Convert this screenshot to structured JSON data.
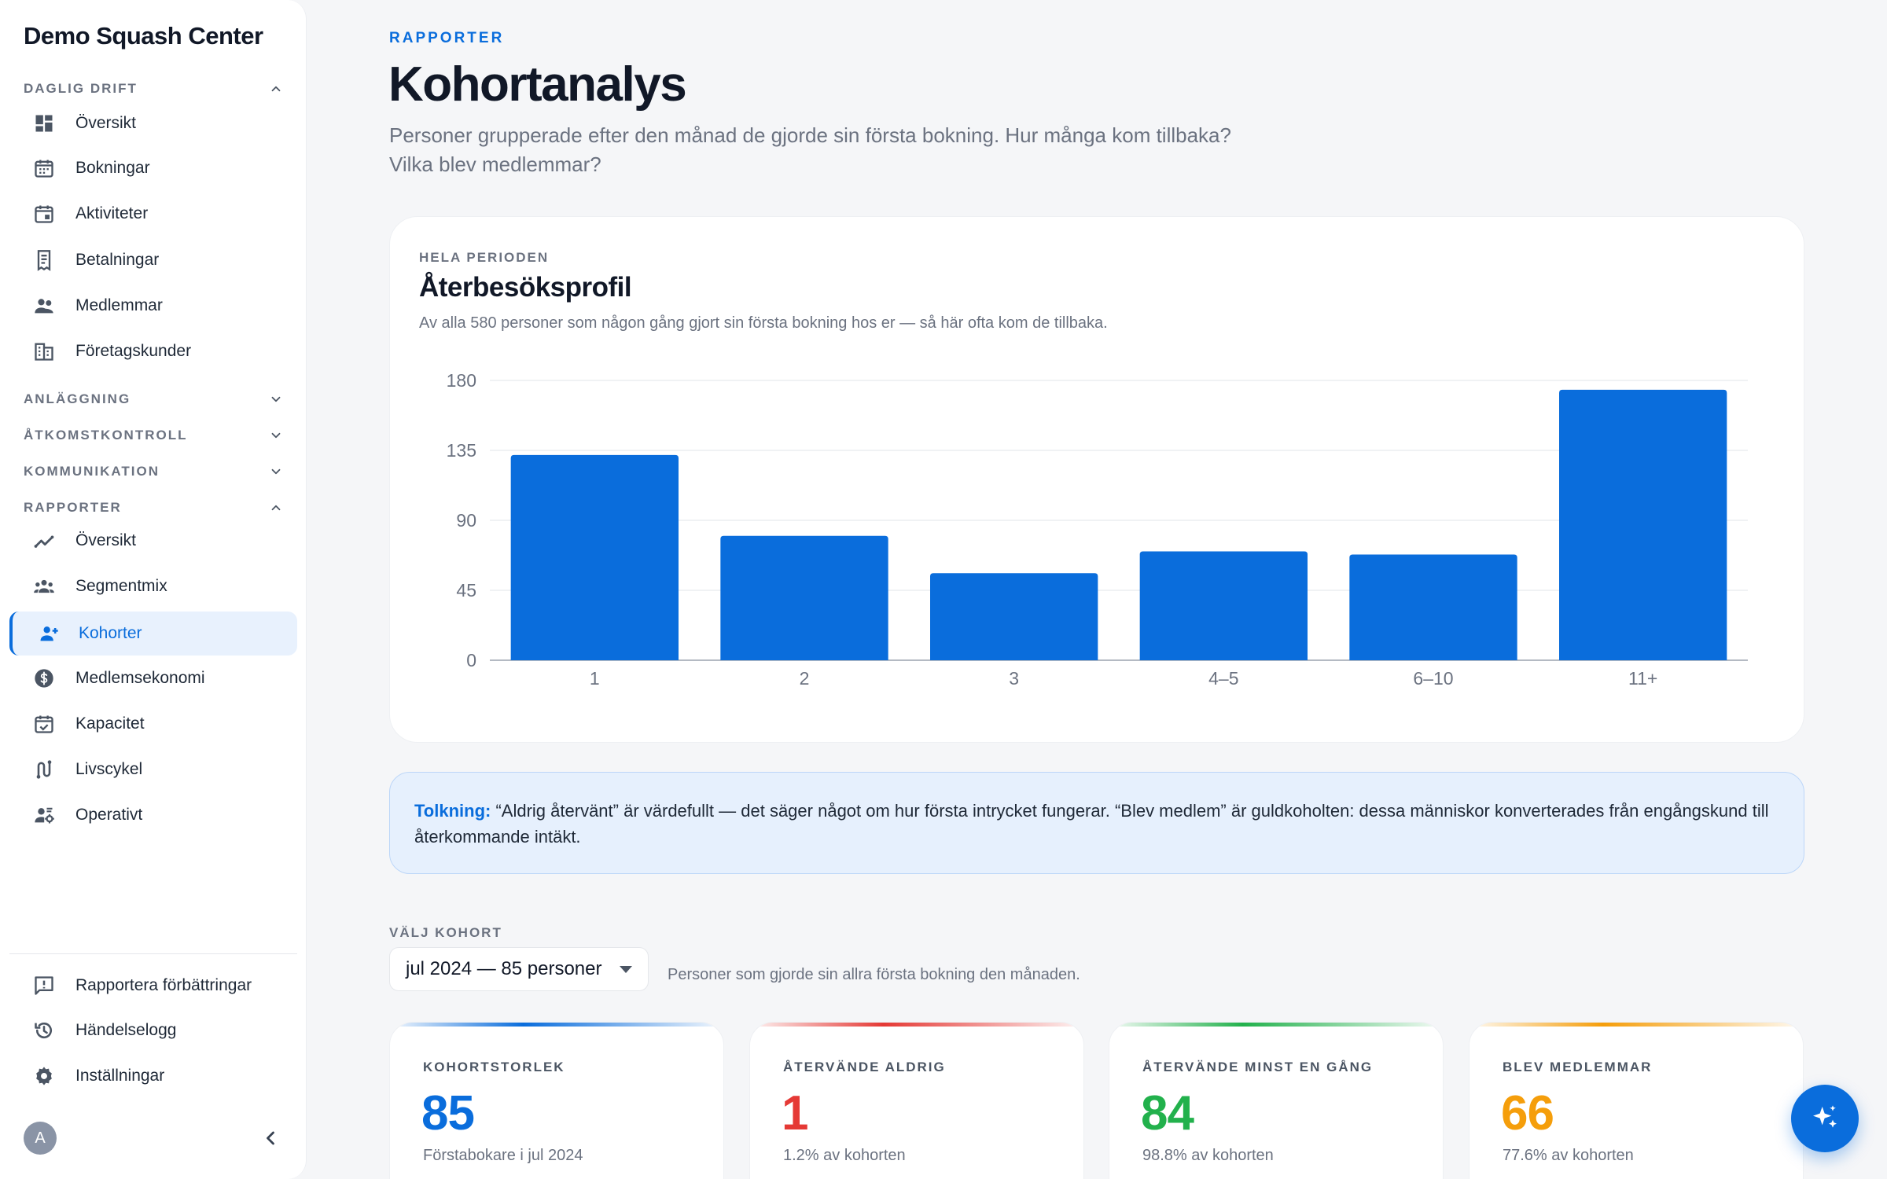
{
  "sidebar": {
    "brand": "Demo Squash Center",
    "sections": {
      "daglig": "DAGLIG DRIFT",
      "anlaggning": "ANLÄGGNING",
      "atkomst": "ÅTKOMSTKONTROLL",
      "kommunikation": "KOMMUNIKATION",
      "rapporter": "RAPPORTER"
    },
    "daglig_items": [
      "Översikt",
      "Bokningar",
      "Aktiviteter",
      "Betalningar",
      "Medlemmar",
      "Företagskunder"
    ],
    "rapport_items": [
      "Översikt",
      "Segmentmix",
      "Kohorter",
      "Medlemsekonomi",
      "Kapacitet",
      "Livscykel",
      "Operativt"
    ],
    "footer_items": [
      "Rapportera förbättringar",
      "Händelselogg",
      "Inställningar"
    ],
    "avatar_initial": "A",
    "active_color": "#0a6ddc"
  },
  "header": {
    "eyebrow": "RAPPORTER",
    "title": "Kohortanalys",
    "subtitle": "Personer grupperade efter den månad de gjorde sin första bokning. Hur många kom tillbaka? Vilka blev medlemmar?"
  },
  "chart_card": {
    "eyebrow": "HELA PERIODEN",
    "title": "Återbesöksprofil",
    "description": "Av alla 580 personer som någon gång gjort sin första bokning hos er — så här ofta kom de tillbaka."
  },
  "chart_data": {
    "type": "bar",
    "categories": [
      "1",
      "2",
      "3",
      "4–5",
      "6–10",
      "11+"
    ],
    "values": [
      132,
      80,
      56,
      70,
      68,
      174
    ],
    "title": "Återbesöksprofil",
    "xlabel": "",
    "ylabel": "",
    "ylim": [
      0,
      180
    ],
    "yticks": [
      0,
      45,
      90,
      135,
      180
    ],
    "grid": true,
    "bar_color": "#0a6ddc"
  },
  "note": {
    "label": "Tolkning:",
    "text": " “Aldrig återvänt” är värdefullt — det säger något om hur första intrycket fungerar. “Blev medlem” är guldkoholten: dessa människor konverterades från engångskund till återkommande intäkt."
  },
  "cohort_picker": {
    "label": "VÄLJ KOHORT",
    "selected": "jul 2024 — 85 personer",
    "hint": "Personer som gjorde sin allra första bokning den månaden."
  },
  "stats": [
    {
      "label": "KOHORTSTORLEK",
      "value": "85",
      "note": "Förstabokare i jul 2024",
      "color": "#0a6ddc"
    },
    {
      "label": "ÅTERVÄNDE ALDRIG",
      "value": "1",
      "note": "1.2% av kohorten",
      "color": "#e53935"
    },
    {
      "label": "ÅTERVÄNDE MINST EN GÅNG",
      "value": "84",
      "note": "98.8% av kohorten",
      "color": "#22b14c"
    },
    {
      "label": "BLEV MEDLEMMAR",
      "value": "66",
      "note": "77.6% av kohorten",
      "color": "#f59e0b"
    }
  ]
}
